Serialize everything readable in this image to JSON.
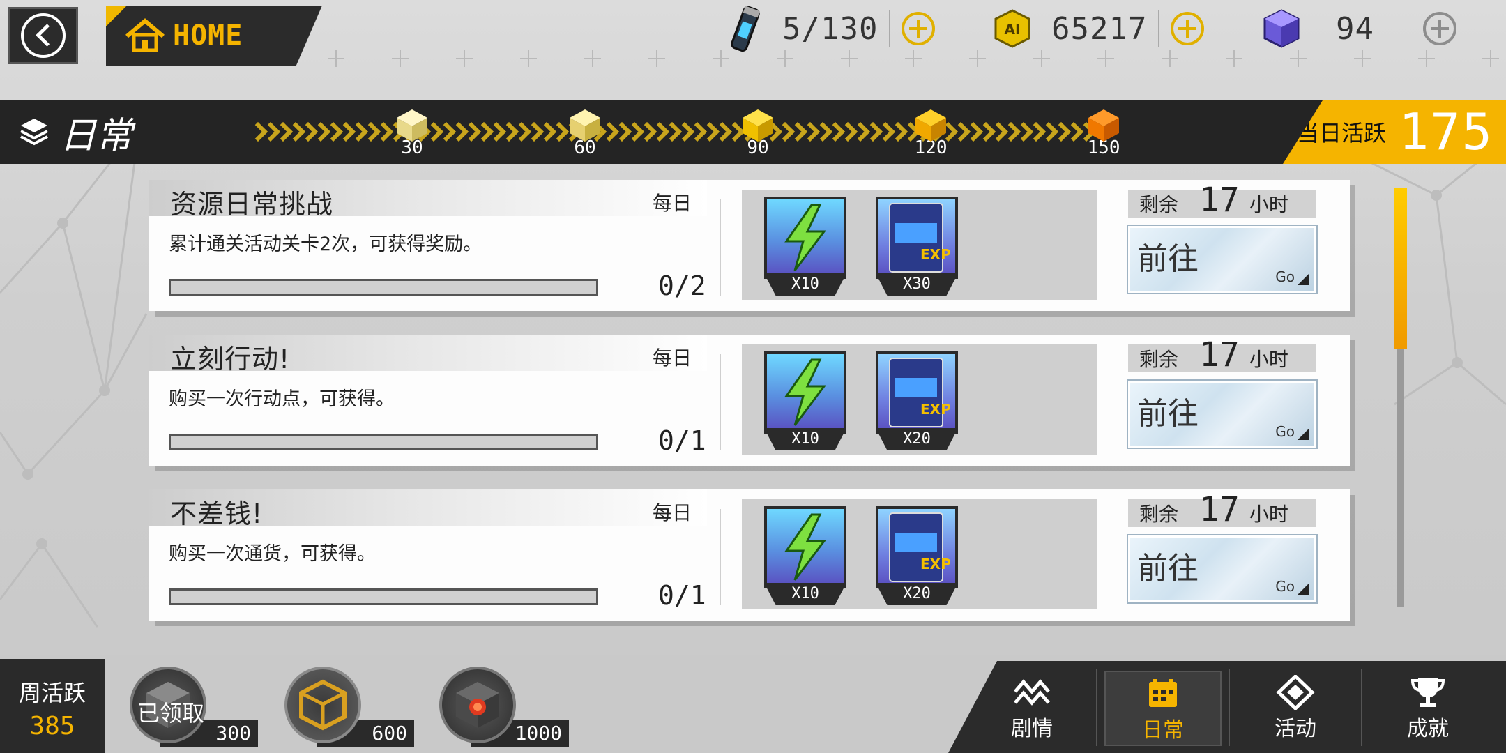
{
  "topbar": {
    "home_label": "HOME",
    "resources": [
      {
        "icon": "energy-vial-icon",
        "value": "5/130"
      },
      {
        "icon": "ai-coin-icon",
        "value": "65217"
      },
      {
        "icon": "crystal-cube-icon",
        "value": "94"
      }
    ]
  },
  "banner": {
    "title": "日常",
    "milestones": [
      "30",
      "60",
      "90",
      "120",
      "150"
    ],
    "active_label": "当日活跃",
    "active_value": "175"
  },
  "tasks": [
    {
      "title": "资源日常挑战",
      "freq": "每日",
      "desc": "累计通关活动关卡2次，可获得奖励。",
      "progress": "0/2",
      "rewards": [
        {
          "icon": "lightning-icon",
          "qty": "X10"
        },
        {
          "icon": "exp-card-icon",
          "qty": "X30"
        }
      ],
      "remain_label": "剩余",
      "remain_value": "17",
      "remain_unit": "小时",
      "go_label": "前往",
      "go_sub": "Go"
    },
    {
      "title": "立刻行动!",
      "freq": "每日",
      "desc": "购买一次行动点，可获得。",
      "progress": "0/1",
      "rewards": [
        {
          "icon": "lightning-icon",
          "qty": "X10"
        },
        {
          "icon": "exp-card-icon",
          "qty": "X20"
        }
      ],
      "remain_label": "剩余",
      "remain_value": "17",
      "remain_unit": "小时",
      "go_label": "前往",
      "go_sub": "Go"
    },
    {
      "title": "不差钱!",
      "freq": "每日",
      "desc": "购买一次通货，可获得。",
      "progress": "0/1",
      "rewards": [
        {
          "icon": "lightning-icon",
          "qty": "X10"
        },
        {
          "icon": "exp-card-icon",
          "qty": "X20"
        }
      ],
      "remain_label": "剩余",
      "remain_value": "17",
      "remain_unit": "小时",
      "go_label": "前往",
      "go_sub": "Go"
    }
  ],
  "weekly": {
    "label": "周活跃",
    "value": "385",
    "chests": [
      {
        "icon": "gray-chest-icon",
        "value": "300",
        "status": "已领取"
      },
      {
        "icon": "gold-frame-chest-icon",
        "value": "600"
      },
      {
        "icon": "red-core-chest-icon",
        "value": "1000"
      }
    ]
  },
  "nav": [
    {
      "label": "剧情",
      "icon": "story-icon"
    },
    {
      "label": "日常",
      "icon": "calendar-icon",
      "active": true
    },
    {
      "label": "活动",
      "icon": "activity-icon"
    },
    {
      "label": "成就",
      "icon": "trophy-icon"
    }
  ],
  "colors": {
    "accent": "#f5b400",
    "dark": "#2b2b2b"
  }
}
